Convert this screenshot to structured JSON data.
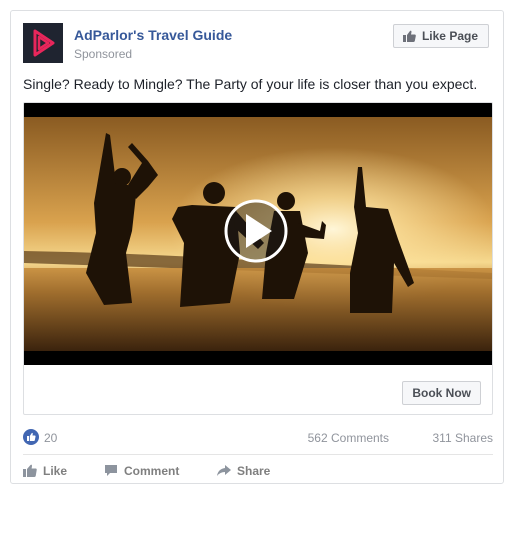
{
  "post": {
    "page_name": "AdParlor's Travel Guide",
    "sponsored_label": "Sponsored",
    "like_page_label": "Like Page",
    "caption": "Single? Ready to Mingle? The Party of your life is closer than you expect.",
    "cta_label": "Book Now"
  },
  "stats": {
    "reactions": "20",
    "comments": "562 Comments",
    "shares": "311 Shares"
  },
  "actions": {
    "like": "Like",
    "comment": "Comment",
    "share": "Share"
  },
  "icons": {
    "logo": "play-triangle-logo",
    "like_page": "thumbs-up-icon",
    "reaction": "like-reaction-icon",
    "like_action": "thumbs-up-icon",
    "comment_action": "comment-bubble-icon",
    "share_action": "share-arrow-icon",
    "video": "play-button-icon"
  },
  "colors": {
    "page_name": "#365899",
    "logo_bg": "#1f2430",
    "logo_accent": "#e8265b",
    "reaction": "#4267b2",
    "muted": "#90949c",
    "action": "#7f7f7f"
  }
}
